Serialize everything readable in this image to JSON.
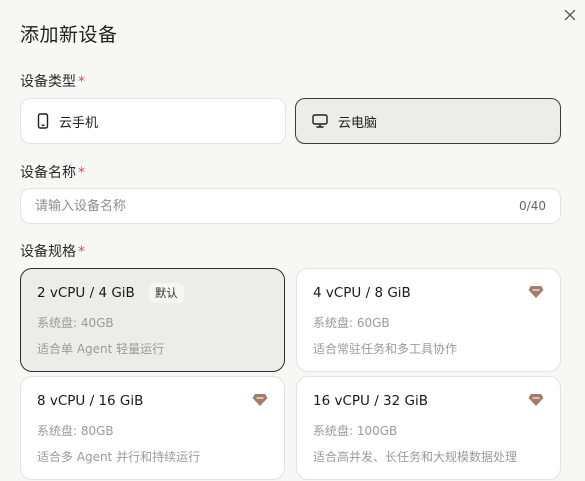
{
  "dialog": {
    "title": "添加新设备",
    "close_icon": "×"
  },
  "device_type": {
    "label": "设备类型",
    "required_mark": "*",
    "options": [
      {
        "label": "云手机",
        "icon": "phone-icon",
        "selected": false
      },
      {
        "label": "云电脑",
        "icon": "monitor-icon",
        "selected": true
      }
    ]
  },
  "device_name": {
    "label": "设备名称",
    "required_mark": "*",
    "placeholder": "请输入设备名称",
    "value": "",
    "counter": "0/40"
  },
  "device_spec": {
    "label": "设备规格",
    "required_mark": "*",
    "options": [
      {
        "title": "2 vCPU / 4 GiB",
        "badge": "默认",
        "disk": "系统盘: 40GB",
        "desc": "适合单 Agent 轻量运行",
        "premium": false,
        "selected": true
      },
      {
        "title": "4 vCPU / 8 GiB",
        "disk": "系统盘: 60GB",
        "desc": "适合常驻任务和多工具协作",
        "premium": true,
        "selected": false
      },
      {
        "title": "8 vCPU / 16 GiB",
        "disk": "系统盘: 80GB",
        "desc": "适合多 Agent 并行和持续运行",
        "premium": true,
        "selected": false
      },
      {
        "title": "16 vCPU / 32 GiB",
        "disk": "系统盘: 100GB",
        "desc": "适合高并发、长任务和大规模数据处理",
        "premium": true,
        "selected": false
      }
    ]
  },
  "colors": {
    "required": "#e5484d",
    "premium_icon": "#a47c6a",
    "selected_border": "#2c2c2c"
  }
}
